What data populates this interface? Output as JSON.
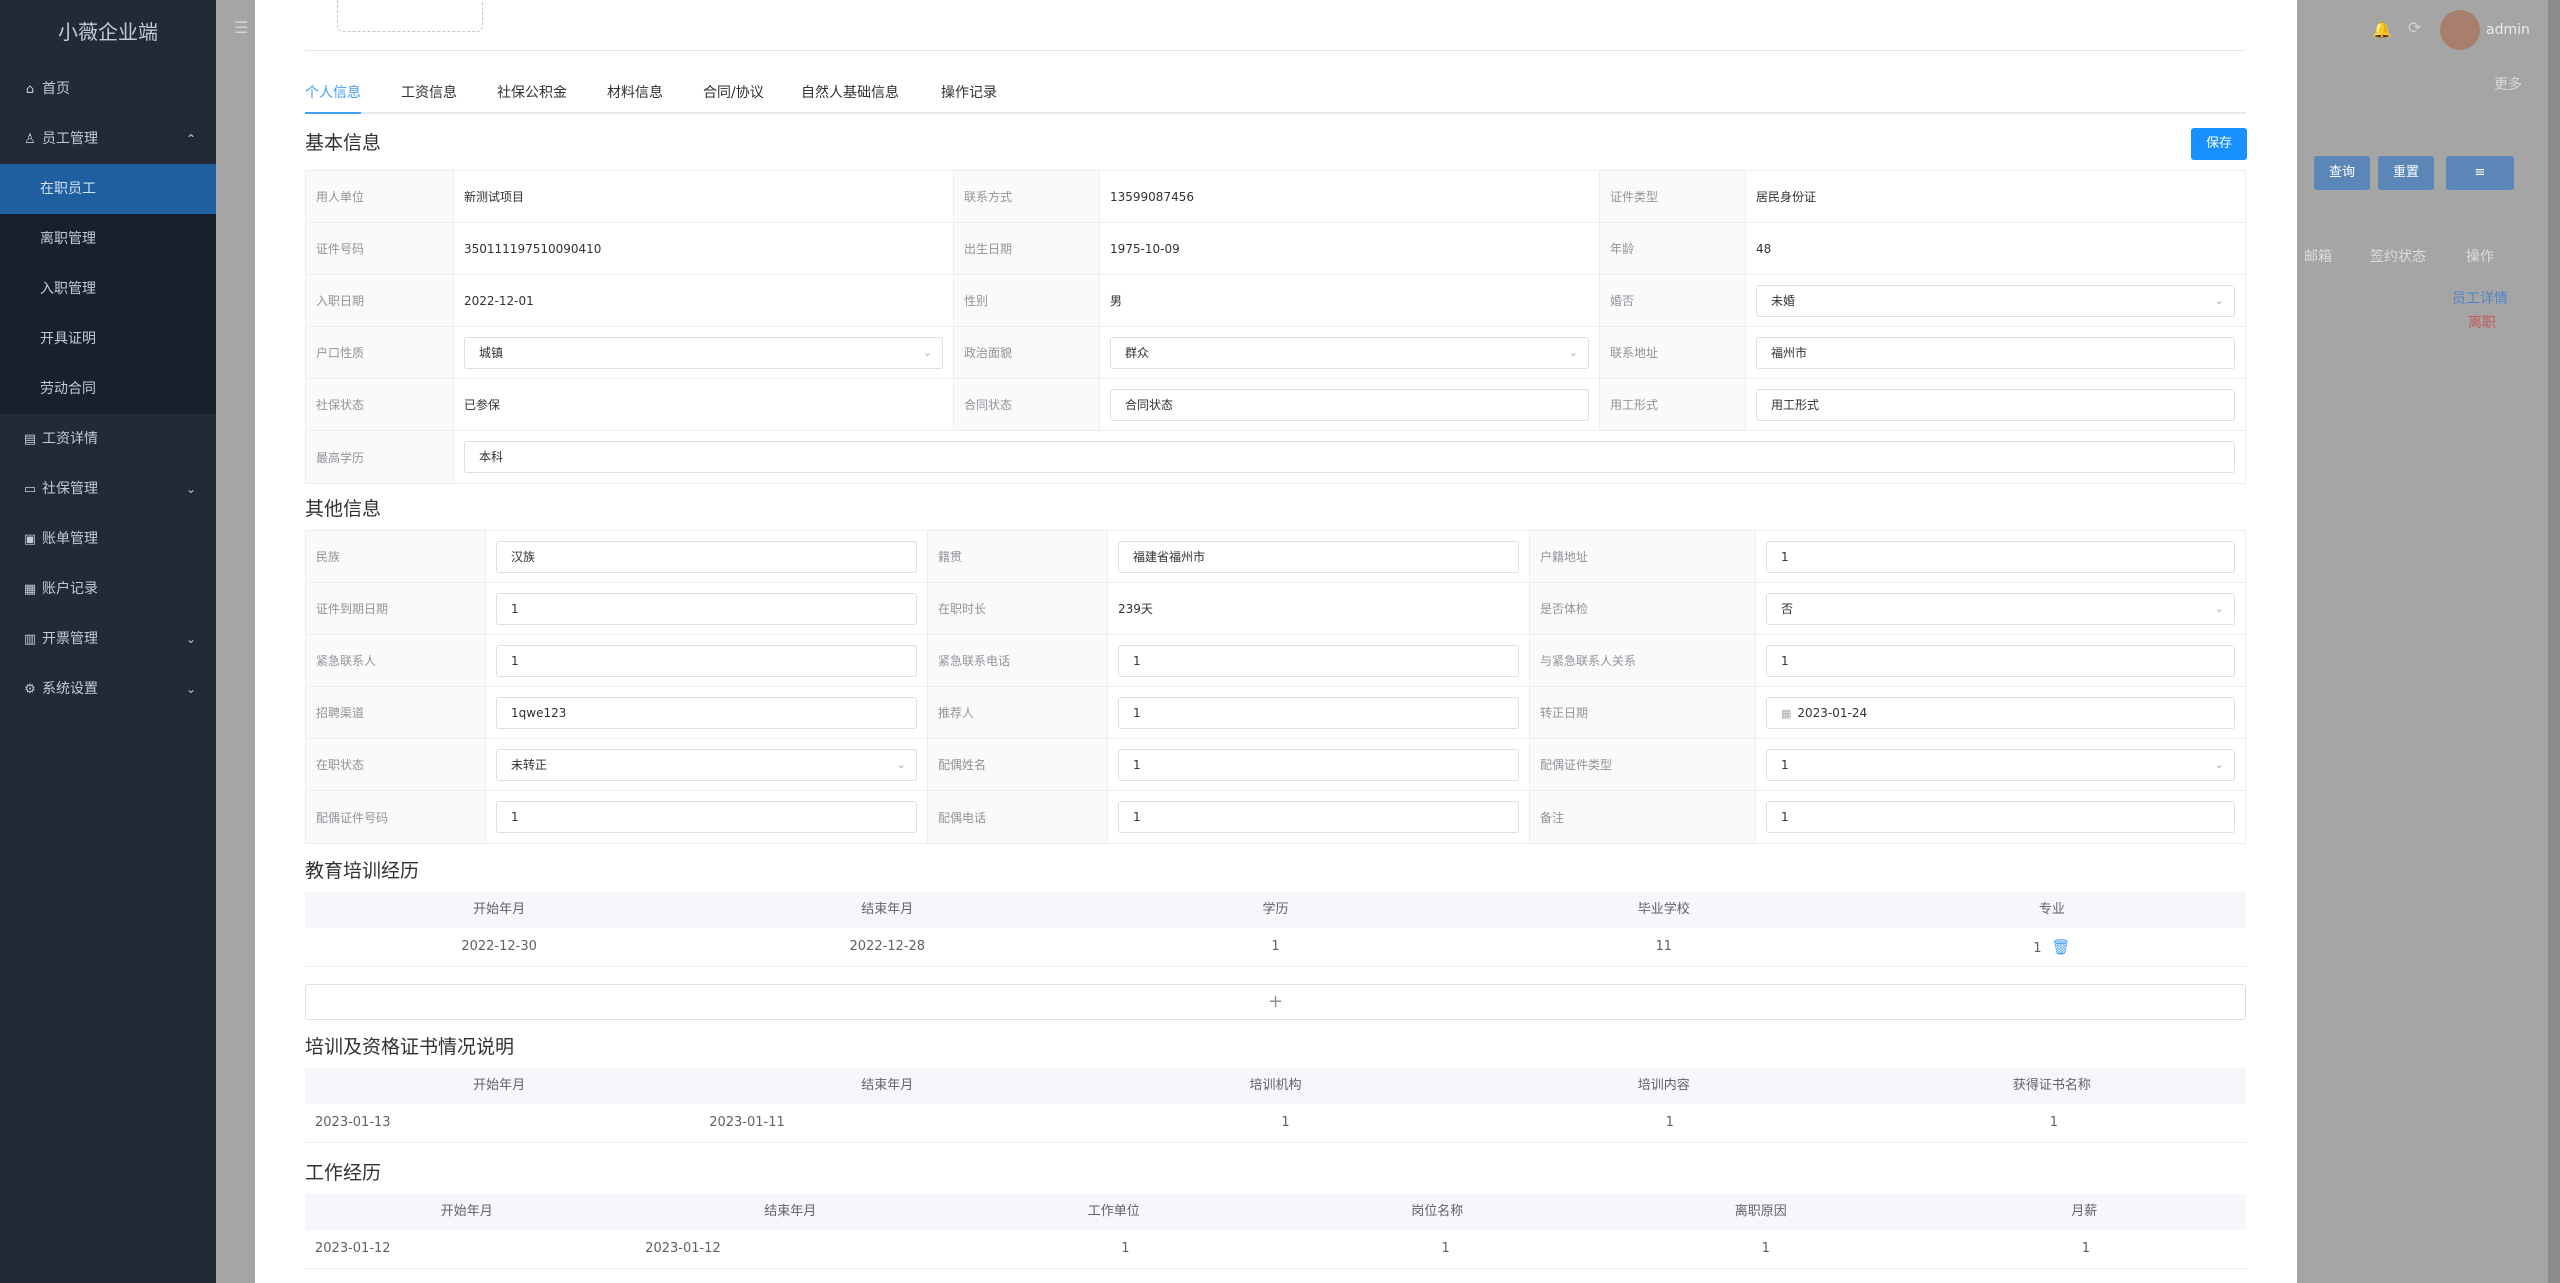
{
  "app": {
    "brand": "小薇企业端"
  },
  "sidebar": {
    "items": [
      {
        "label": "首页",
        "icon": "⌂"
      },
      {
        "label": "员工管理",
        "icon": "♙",
        "arrow": "⌃"
      },
      {
        "label": "在职员工"
      },
      {
        "label": "离职管理"
      },
      {
        "label": "入职管理"
      },
      {
        "label": "开具证明"
      },
      {
        "label": "劳动合同"
      },
      {
        "label": "工资详情",
        "icon": "▤"
      },
      {
        "label": "社保管理",
        "icon": "▭",
        "arrow": "⌄"
      },
      {
        "label": "账单管理",
        "icon": "▣"
      },
      {
        "label": "账户记录",
        "icon": "▦"
      },
      {
        "label": "开票管理",
        "icon": "▥",
        "arrow": "⌄"
      },
      {
        "label": "系统设置",
        "icon": "⚙",
        "arrow": "⌄"
      }
    ]
  },
  "header": {
    "user": "admin",
    "more": "更多",
    "icons": {
      "bell": "🔔",
      "refresh": "⟳"
    }
  },
  "background": {
    "buttons": {
      "query": "查询",
      "reset": "重置",
      "menu": "≡"
    },
    "columns": [
      "邮箱",
      "签约状态",
      "操作"
    ],
    "actions": [
      "员工详情",
      "离职"
    ]
  },
  "tabs": [
    {
      "label": "个人信息",
      "active": true
    },
    {
      "label": "工资信息"
    },
    {
      "label": "社保公积金"
    },
    {
      "label": "材料信息"
    },
    {
      "label": "合同/协议"
    },
    {
      "label": "自然人基础信息"
    },
    {
      "label": "操作记录"
    }
  ],
  "basic": {
    "title": "基本信息",
    "save": "保存",
    "rows": [
      [
        {
          "label": "用人单位",
          "value": "新测试项目"
        },
        {
          "label": "联系方式",
          "value": "13599087456"
        },
        {
          "label": "证件类型",
          "value": "居民身份证"
        }
      ],
      [
        {
          "label": "证件号码",
          "value": "350111197510090410"
        },
        {
          "label": "出生日期",
          "value": "1975-10-09"
        },
        {
          "label": "年龄",
          "value": "48"
        }
      ],
      [
        {
          "label": "入职日期",
          "value": "2022-12-01"
        },
        {
          "label": "性别",
          "value": "男"
        },
        {
          "label": "婚否",
          "value": "未婚"
        }
      ],
      [
        {
          "label": "户口性质",
          "value": "城镇"
        },
        {
          "label": "政治面貌",
          "value": "群众"
        },
        {
          "label": "联系地址",
          "value": "福州市"
        }
      ],
      [
        {
          "label": "社保状态",
          "value": "已参保"
        },
        {
          "label": "合同状态",
          "value": "合同状态"
        },
        {
          "label": "用工形式",
          "value": "用工形式"
        }
      ],
      [
        {
          "label": "最高学历",
          "value": "本科"
        }
      ]
    ]
  },
  "other": {
    "title": "其他信息",
    "rows": [
      [
        {
          "label": "民族",
          "value": "汉族"
        },
        {
          "label": "籍贯",
          "value": "福建省福州市"
        },
        {
          "label": "户籍地址",
          "value": "1"
        }
      ],
      [
        {
          "label": "证件到期日期",
          "value": "1"
        },
        {
          "label": "在职时长",
          "value": "239天"
        },
        {
          "label": "是否体检",
          "value": "否"
        }
      ],
      [
        {
          "label": "紧急联系人",
          "value": "1"
        },
        {
          "label": "紧急联系电话",
          "value": "1"
        },
        {
          "label": "与紧急联系人关系",
          "value": "1"
        }
      ],
      [
        {
          "label": "招聘渠道",
          "value": "1qwe123"
        },
        {
          "label": "推荐人",
          "value": "1"
        },
        {
          "label": "转正日期",
          "value": "2023-01-24"
        }
      ],
      [
        {
          "label": "在职状态",
          "value": "未转正"
        },
        {
          "label": "配偶姓名",
          "value": "1"
        },
        {
          "label": "配偶证件类型",
          "value": "1"
        }
      ],
      [
        {
          "label": "配偶证件号码",
          "value": "1"
        },
        {
          "label": "配偶电话",
          "value": "1"
        },
        {
          "label": "备注",
          "value": "1"
        }
      ]
    ]
  },
  "education": {
    "title": "教育培训经历",
    "columns": [
      "开始年月",
      "结束年月",
      "学历",
      "毕业学校",
      "专业"
    ],
    "rows": [
      [
        "2022-12-30",
        "2022-12-28",
        "1",
        "11",
        "1"
      ]
    ],
    "add": "+"
  },
  "training": {
    "title": "培训及资格证书情况说明",
    "columns": [
      "开始年月",
      "结束年月",
      "培训机构",
      "培训内容",
      "获得证书名称"
    ],
    "rows": [
      [
        "2023-01-13",
        "2023-01-11",
        "1",
        "1",
        "1"
      ]
    ]
  },
  "work": {
    "title": "工作经历",
    "columns": [
      "开始年月",
      "结束年月",
      "工作单位",
      "岗位名称",
      "离职原因",
      "月薪"
    ],
    "rows": [
      [
        "2023-01-12",
        "2023-01-12",
        "1",
        "1",
        "1",
        "1"
      ]
    ]
  }
}
